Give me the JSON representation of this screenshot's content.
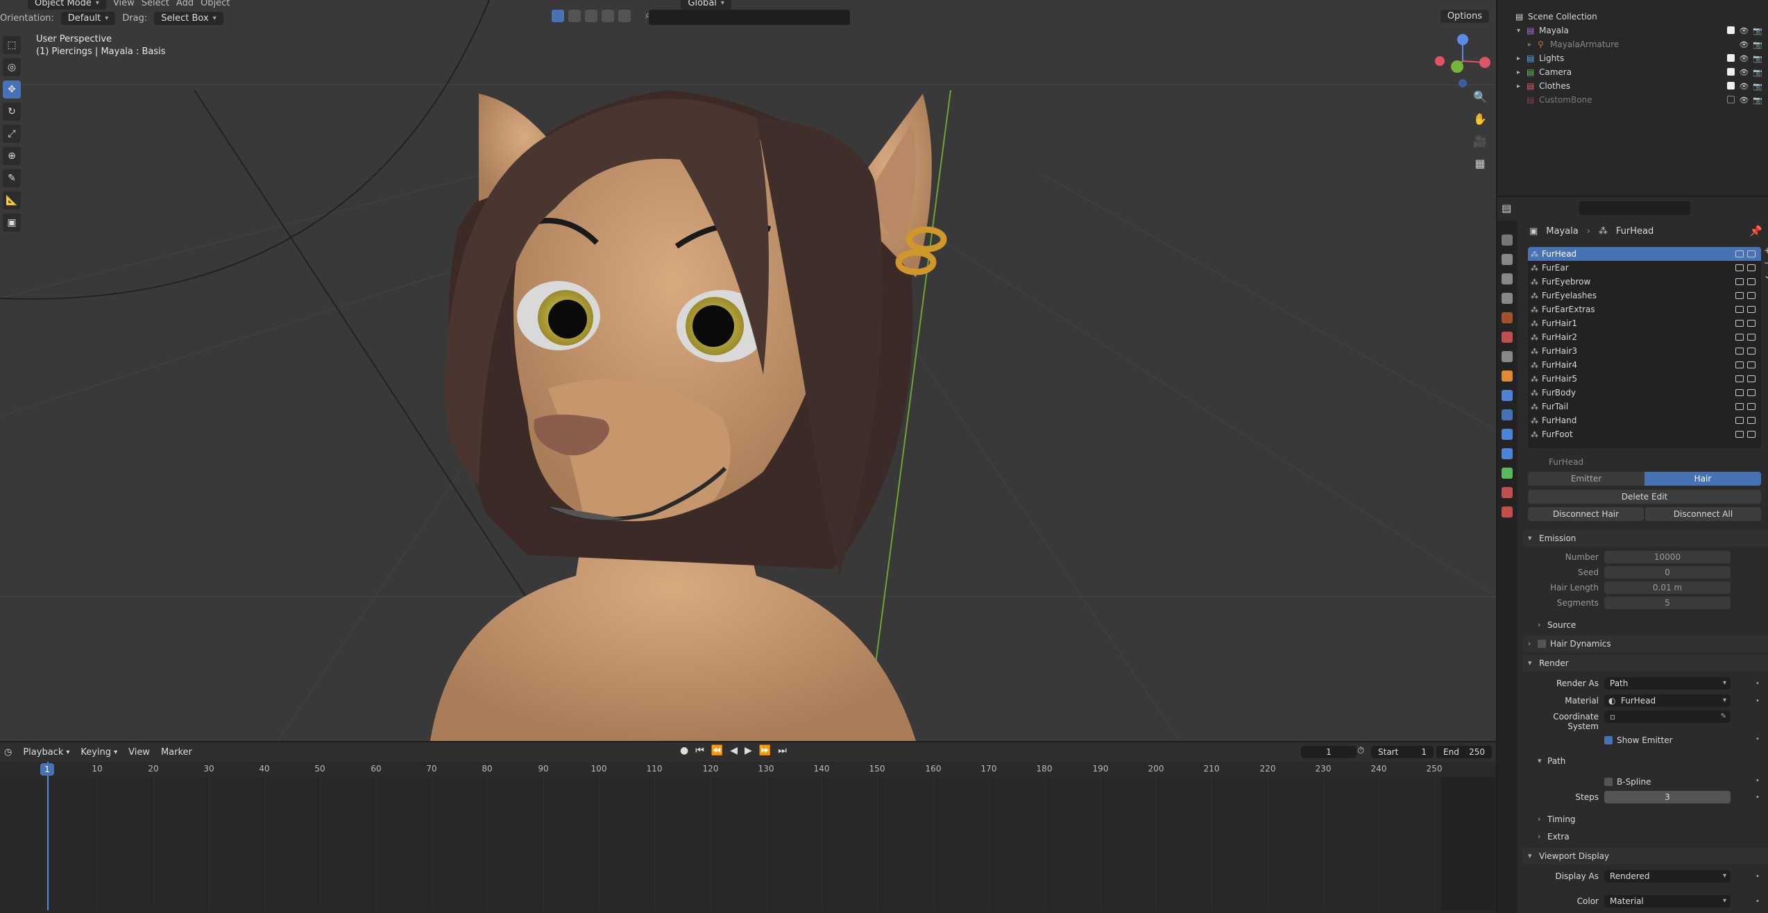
{
  "viewport": {
    "header": {
      "mode": "Object Mode",
      "menus": [
        "View",
        "Select",
        "Add",
        "Object"
      ],
      "orientation_label": "Orientation:",
      "orientation_value": "Default",
      "drag_label": "Drag:",
      "drag_value": "Select Box",
      "transform_orientation": "Global",
      "options": "Options"
    },
    "info_line1": "User Perspective",
    "info_line2": "(1) Piercings | Mayala : Basis",
    "gizmo": {
      "x": "X",
      "y": "Y",
      "z": "Z"
    }
  },
  "timeline": {
    "menus": [
      "Playback",
      "Keying",
      "View",
      "Marker"
    ],
    "current_frame": "1",
    "start_label": "Start",
    "start_value": "1",
    "end_label": "End",
    "end_value": "250",
    "playhead": "1",
    "ticks": [
      "10",
      "20",
      "30",
      "40",
      "50",
      "60",
      "70",
      "80",
      "90",
      "100",
      "110",
      "120",
      "130",
      "140",
      "150",
      "160",
      "170",
      "180",
      "190",
      "200",
      "210",
      "220",
      "230",
      "240",
      "250"
    ]
  },
  "outliner": {
    "items": [
      {
        "name": "Scene Collection"
      },
      {
        "name": "Mayala"
      },
      {
        "name": "MayalaArmature"
      },
      {
        "name": "Lights"
      },
      {
        "name": "Camera"
      },
      {
        "name": "Clothes"
      },
      {
        "name": "CustomBone"
      }
    ]
  },
  "properties": {
    "breadcrumb": [
      "Mayala",
      "FurHead"
    ],
    "particle_systems": [
      "FurHead",
      "FurEar",
      "FurEyebrow",
      "FurEyelashes",
      "FurEarExtras",
      "FurHair1",
      "FurHair2",
      "FurHair3",
      "FurHair4",
      "FurHair5",
      "FurBody",
      "FurTail",
      "FurHand",
      "FurFoot"
    ],
    "selected_system": "FurHead",
    "settings_name": "FurHead",
    "type_emitter": "Emitter",
    "type_hair": "Hair",
    "delete_edit": "Delete Edit",
    "disconnect_hair": "Disconnect Hair",
    "disconnect_all": "Disconnect All",
    "emission": {
      "title": "Emission",
      "number_label": "Number",
      "number": "10000",
      "seed_label": "Seed",
      "seed": "0",
      "hair_length_label": "Hair Length",
      "hair_length": "0.01 m",
      "segments_label": "Segments",
      "segments": "5",
      "source": "Source"
    },
    "hair_dynamics": "Hair Dynamics",
    "render": {
      "title": "Render",
      "render_as_label": "Render As",
      "render_as": "Path",
      "material_label": "Material",
      "material": "FurHead",
      "coord_label": "Coordinate System",
      "show_emitter": "Show Emitter",
      "path": "Path",
      "bspline": "B-Spline",
      "steps_label": "Steps",
      "steps": "3",
      "timing": "Timing",
      "extra": "Extra"
    },
    "viewport_display": {
      "title": "Viewport Display",
      "display_as_label": "Display As",
      "display_as": "Rendered",
      "color_label": "Color",
      "color": "Material"
    }
  },
  "colors": {
    "accent": "#4772b3",
    "skin": "#c89a70",
    "hair": "#4a3630"
  }
}
